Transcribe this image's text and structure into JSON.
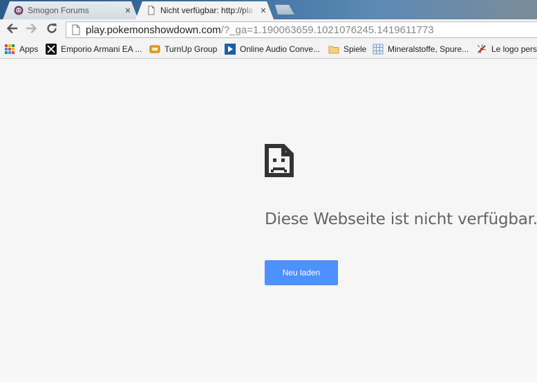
{
  "tabs": [
    {
      "title": "Smogon Forums",
      "close": "✕",
      "favicon": "smogon-favicon-icon",
      "active": false
    },
    {
      "title": "Nicht verfügbar: http://pla",
      "close": "✕",
      "favicon": "page-icon",
      "active": true
    }
  ],
  "toolbar": {
    "back": "back-arrow-icon",
    "forward": "forward-arrow-icon",
    "reload": "reload-icon",
    "url_host": "play.pokemonshowdown.com",
    "url_rest": "/?_ga=1.190063659.1021076245.1419611773"
  },
  "bookmarks": [
    {
      "label": "Apps",
      "icon": "apps-grid-icon"
    },
    {
      "label": "Emporio Armani EA ...",
      "icon": "ea-logo-icon"
    },
    {
      "label": "TurnUp Group",
      "icon": "turnup-icon"
    },
    {
      "label": "Online Audio Conve...",
      "icon": "play-icon"
    },
    {
      "label": "Spiele",
      "icon": "folder-icon"
    },
    {
      "label": "Mineralstoffe, Spure...",
      "icon": "grid-site-icon"
    },
    {
      "label": "Le logo pers",
      "icon": "mosquito-icon"
    }
  ],
  "error": {
    "icon": "sad-page-icon",
    "title": "Diese Webseite ist nicht verfügbar.",
    "button": "Neu laden"
  },
  "colors": {
    "accent": "#4d90fe",
    "title": "#646464",
    "background": "#f6f6f6"
  }
}
